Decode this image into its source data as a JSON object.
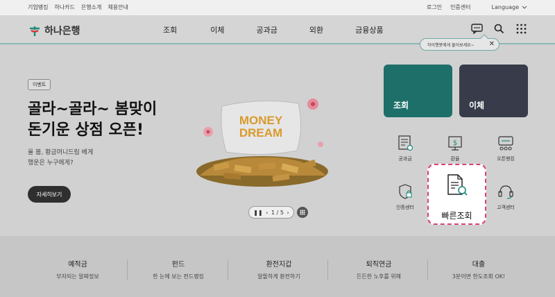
{
  "utility": {
    "left_links": [
      "기업뱅킹",
      "하나카드",
      "은행소개",
      "채용안내"
    ],
    "login": "로그인",
    "cert_center": "인증센터",
    "language": "Language"
  },
  "header": {
    "logo_text": "하나은행",
    "nav": [
      "조회",
      "이체",
      "공과금",
      "외환",
      "금융상품"
    ],
    "chat_tooltip": "하이챗봇에게 물어보세요~"
  },
  "hero": {
    "badge": "이벤트",
    "title_line1": "골라~골라~ 봄맞이",
    "title_line2": "돈기운 상점 오픈!",
    "sub_line1": "올 봄, 황금머니드림 베게",
    "sub_line2": "행운은 누구에게?",
    "detail_button": "자세히보기",
    "pager": "1 / 5",
    "image_text_line1": "MONEY",
    "image_text_line2": "DREAM"
  },
  "quick": {
    "card_inquiry": "조회",
    "card_transfer": "이체",
    "bill": "공과금",
    "exchange": "환율",
    "openbanking": "오픈뱅킹",
    "cert": "인증센터",
    "fast_inquiry": "빠른조회",
    "customer": "고객센터"
  },
  "products": [
    {
      "title": "예적금",
      "sub": "부자되는 알짜정보"
    },
    {
      "title": "펀드",
      "sub": "한 눈에 보는 펀드랭킹"
    },
    {
      "title": "환전지갑",
      "sub": "알뜰하게 환전하기"
    },
    {
      "title": "퇴직연금",
      "sub": "든든한 노후를 위해"
    },
    {
      "title": "대출",
      "sub": "3분이면 한도조회 OK!"
    }
  ],
  "colors": {
    "brand_teal": "#1e6f6a",
    "navy": "#373b4a",
    "highlight_border": "#d9417a"
  }
}
